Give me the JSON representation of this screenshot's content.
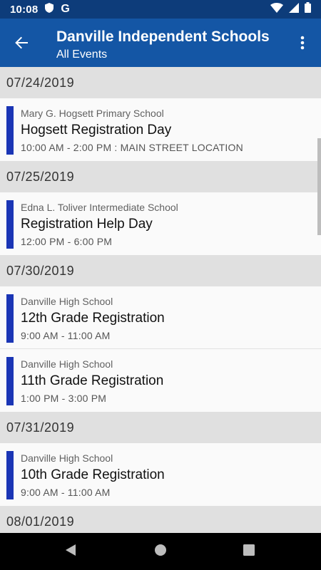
{
  "status_bar": {
    "time": "10:08",
    "g_label": "G",
    "icons": [
      "shield-icon",
      "google-icon",
      "wifi-icon",
      "signal-icon",
      "battery-icon"
    ]
  },
  "app_bar": {
    "title": "Danville Independent Schools",
    "subtitle": "All Events",
    "back_icon": "arrow-back-icon",
    "more_icon": "more-vert-icon",
    "background": "#1456a5",
    "status_background": "#0d3c7a"
  },
  "accent": "#1a35b5",
  "groups": [
    {
      "date": "07/24/2019",
      "events": [
        {
          "school": "Mary G. Hogsett Primary School",
          "title": "Hogsett Registration Day",
          "time": "10:00 AM - 2:00 PM : MAIN STREET LOCATION"
        }
      ]
    },
    {
      "date": "07/25/2019",
      "events": [
        {
          "school": "Edna L. Toliver Intermediate School",
          "title": "Registration Help Day",
          "time": "12:00 PM - 6:00 PM"
        }
      ]
    },
    {
      "date": "07/30/2019",
      "events": [
        {
          "school": "Danville High School",
          "title": "12th Grade Registration",
          "time": "9:00 AM - 11:00 AM"
        },
        {
          "school": "Danville High School",
          "title": "11th Grade Registration",
          "time": "1:00 PM - 3:00 PM"
        }
      ]
    },
    {
      "date": "07/31/2019",
      "events": [
        {
          "school": "Danville High School",
          "title": "10th Grade Registration",
          "time": "9:00 AM - 11:00 AM"
        }
      ]
    },
    {
      "date": "08/01/2019",
      "events": []
    }
  ],
  "nav_bar": {
    "icons": [
      "back-triangle-icon",
      "home-circle-icon",
      "recents-square-icon"
    ]
  }
}
